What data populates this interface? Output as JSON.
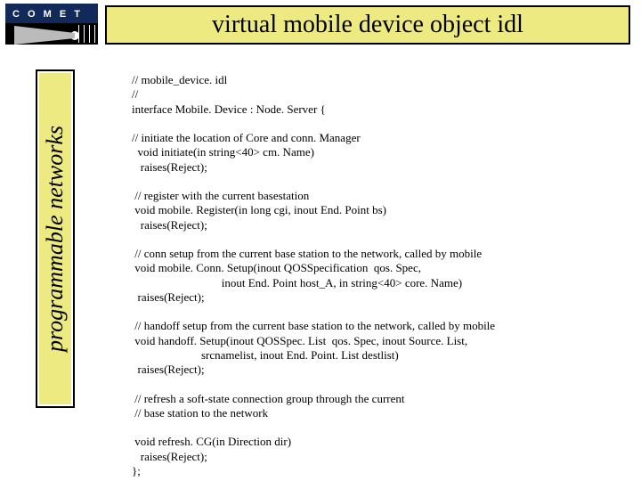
{
  "header": {
    "title": "virtual mobile device object idl",
    "logo_label": "C O M E T"
  },
  "sidebar": {
    "label": "programmable networks"
  },
  "code": {
    "line1": "// mobile_device. idl",
    "line2": "//",
    "line3": "interface Mobile. Device : Node. Server {",
    "blank1": "",
    "comment_initiate": "// initiate the location of Core and conn. Manager",
    "initiate_sig": "  void initiate(in string<40> cm. Name)",
    "initiate_raise": "   raises(Reject);",
    "blank2": "",
    "comment_register": " // register with the current basestation",
    "register_sig": " void mobile. Register(in long cgi, inout End. Point bs)",
    "register_raise": "   raises(Reject);",
    "blank3": "",
    "comment_connsetup": " // conn setup from the current base station to the network, called by mobile",
    "connsetup_sig1": " void mobile. Conn. Setup(inout QOSSpecification  qos. Spec,",
    "connsetup_sig2": "                               inout End. Point host_A, in string<40> core. Name)",
    "connsetup_raise": "  raises(Reject);",
    "blank4": "",
    "comment_handoff": " // handoff setup from the current base station to the network, called by mobile",
    "handoff_sig1": " void handoff. Setup(inout QOSSpec. List  qos. Spec, inout Source. List,",
    "handoff_sig2": "                        srcnamelist, inout End. Point. List destlist)",
    "handoff_raise": "  raises(Reject);",
    "blank5": "",
    "comment_refresh1": " // refresh a soft-state connection group through the current",
    "comment_refresh2": " // base station to the network",
    "blank6": "",
    "refresh_sig": " void refresh. CG(in Direction dir)",
    "refresh_raise": "   raises(Reject);",
    "close": "};"
  }
}
